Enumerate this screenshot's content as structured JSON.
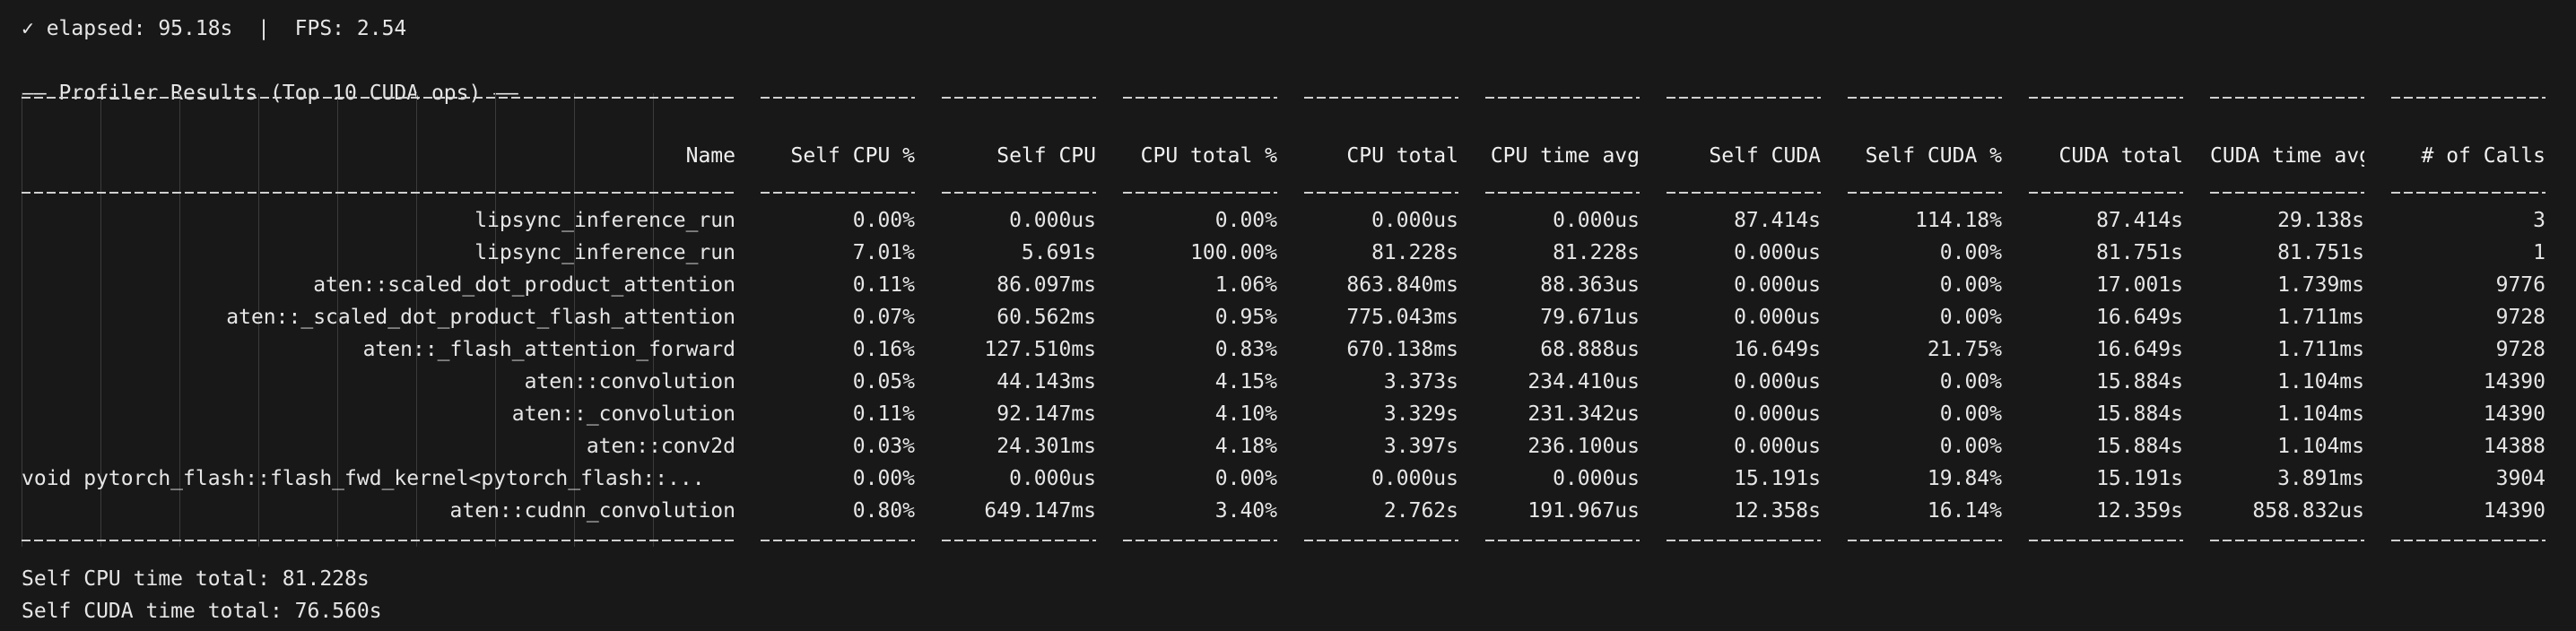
{
  "status": "✓ elapsed: 95.18s  |  FPS: 2.54",
  "section_title": "—— Profiler Results (Top 10 CUDA ops) ——",
  "table": {
    "headers": [
      "Name",
      "Self CPU %",
      "Self CPU",
      "CPU total %",
      "CPU total",
      "CPU time avg",
      "Self CUDA",
      "Self CUDA %",
      "CUDA total",
      "CUDA time avg",
      "# of Calls"
    ],
    "rows": [
      [
        "lipsync_inference_run",
        "0.00%",
        "0.000us",
        "0.00%",
        "0.000us",
        "0.000us",
        "87.414s",
        "114.18%",
        "87.414s",
        "29.138s",
        "3"
      ],
      [
        "lipsync_inference_run",
        "7.01%",
        "5.691s",
        "100.00%",
        "81.228s",
        "81.228s",
        "0.000us",
        "0.00%",
        "81.751s",
        "81.751s",
        "1"
      ],
      [
        "aten::scaled_dot_product_attention",
        "0.11%",
        "86.097ms",
        "1.06%",
        "863.840ms",
        "88.363us",
        "0.000us",
        "0.00%",
        "17.001s",
        "1.739ms",
        "9776"
      ],
      [
        "aten::_scaled_dot_product_flash_attention",
        "0.07%",
        "60.562ms",
        "0.95%",
        "775.043ms",
        "79.671us",
        "0.000us",
        "0.00%",
        "16.649s",
        "1.711ms",
        "9728"
      ],
      [
        "aten::_flash_attention_forward",
        "0.16%",
        "127.510ms",
        "0.83%",
        "670.138ms",
        "68.888us",
        "16.649s",
        "21.75%",
        "16.649s",
        "1.711ms",
        "9728"
      ],
      [
        "aten::convolution",
        "0.05%",
        "44.143ms",
        "4.15%",
        "3.373s",
        "234.410us",
        "0.000us",
        "0.00%",
        "15.884s",
        "1.104ms",
        "14390"
      ],
      [
        "aten::_convolution",
        "0.11%",
        "92.147ms",
        "4.10%",
        "3.329s",
        "231.342us",
        "0.000us",
        "0.00%",
        "15.884s",
        "1.104ms",
        "14390"
      ],
      [
        "aten::conv2d",
        "0.03%",
        "24.301ms",
        "4.18%",
        "3.397s",
        "236.100us",
        "0.000us",
        "0.00%",
        "15.884s",
        "1.104ms",
        "14388"
      ],
      [
        "void pytorch_flash::flash_fwd_kernel<pytorch_flash::...",
        "0.00%",
        "0.000us",
        "0.00%",
        "0.000us",
        "0.000us",
        "15.191s",
        "19.84%",
        "15.191s",
        "3.891ms",
        "3904"
      ],
      [
        "aten::cudnn_convolution",
        "0.80%",
        "649.147ms",
        "3.40%",
        "2.762s",
        "191.967us",
        "12.358s",
        "16.14%",
        "12.359s",
        "858.832us",
        "14390"
      ]
    ]
  },
  "footer": {
    "self_cpu_total": "Self CPU time total: 81.228s",
    "self_cuda_total": "Self CUDA time total: 76.560s"
  }
}
